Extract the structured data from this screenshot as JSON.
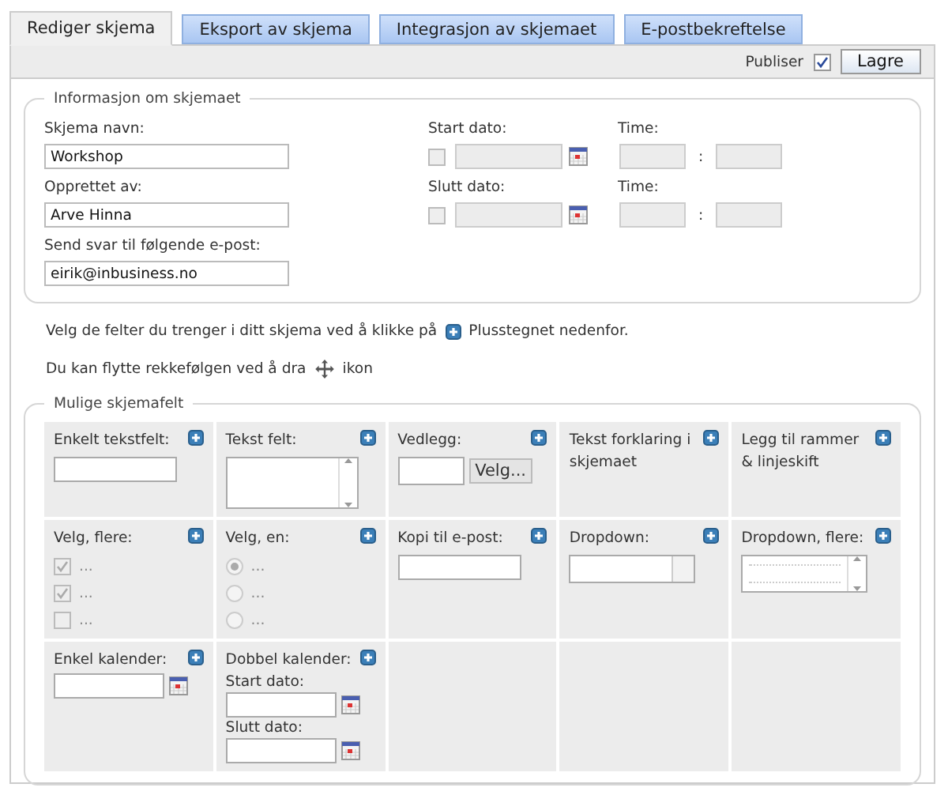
{
  "tabs": [
    {
      "label": "Rediger skjema",
      "selected": true
    },
    {
      "label": "Eksport av skjema",
      "selected": false
    },
    {
      "label": "Integrasjon av skjemaet",
      "selected": false
    },
    {
      "label": "E-postbekreftelse",
      "selected": false
    }
  ],
  "toolbar": {
    "publish_label": "Publiser",
    "publish_checked": true,
    "save_button": "Lagre"
  },
  "info": {
    "legend": "Informasjon om skjemaet",
    "fields": [
      {
        "label": "Skjema navn:",
        "value": "Workshop"
      },
      {
        "label": "Opprettet av:",
        "value": "Arve Hinna"
      },
      {
        "label": "Send svar til følgende e-post:",
        "value": "eirik@inbusiness.no"
      }
    ],
    "dates": [
      {
        "label": "Start dato:",
        "checked": false,
        "time_label": "Time:",
        "time_separator": ":"
      },
      {
        "label": "Slutt dato:",
        "checked": false,
        "time_label": "Time:",
        "time_separator": ":"
      }
    ]
  },
  "instructions": [
    {
      "before": "Velg de felter du trenger i ditt skjema ved å klikke på",
      "kind": "plus",
      "after": "Plusstegnet nedenfor."
    },
    {
      "before": "Du kan flytte rekkefølgen ved å dra",
      "kind": "move",
      "after": "ikon"
    }
  ],
  "fields": {
    "legend": "Mulige skjemafelt",
    "cells": [
      {
        "kind": "text",
        "label": "Enkelt tekstfelt:"
      },
      {
        "kind": "textarea",
        "label": "Tekst felt:"
      },
      {
        "kind": "file",
        "label": "Vedlegg:",
        "button": "Velg..."
      },
      {
        "kind": "note",
        "label": "Tekst forklaring i skjemaet"
      },
      {
        "kind": "note",
        "label": "Legg til rammer & linjeskift"
      },
      {
        "kind": "checks",
        "label": "Velg, flere:",
        "options": [
          {
            "label": "...",
            "checked": true
          },
          {
            "label": "...",
            "checked": true
          },
          {
            "label": "...",
            "checked": false
          }
        ]
      },
      {
        "kind": "radios",
        "label": "Velg, en:",
        "options": [
          {
            "label": "...",
            "selected": true
          },
          {
            "label": "...",
            "selected": false
          },
          {
            "label": "...",
            "selected": false
          }
        ]
      },
      {
        "kind": "text",
        "label": "Kopi til e-post:"
      },
      {
        "kind": "dropdown",
        "label": "Dropdown:"
      },
      {
        "kind": "multiselect",
        "label": "Dropdown, flere:"
      },
      {
        "kind": "calendar",
        "label": "Enkel kalender:"
      },
      {
        "kind": "double-calendar",
        "label": "Dobbel kalender:",
        "start_label": "Start dato:",
        "end_label": "Slutt dato:"
      },
      {
        "kind": "empty"
      },
      {
        "kind": "empty"
      },
      {
        "kind": "empty"
      }
    ]
  }
}
